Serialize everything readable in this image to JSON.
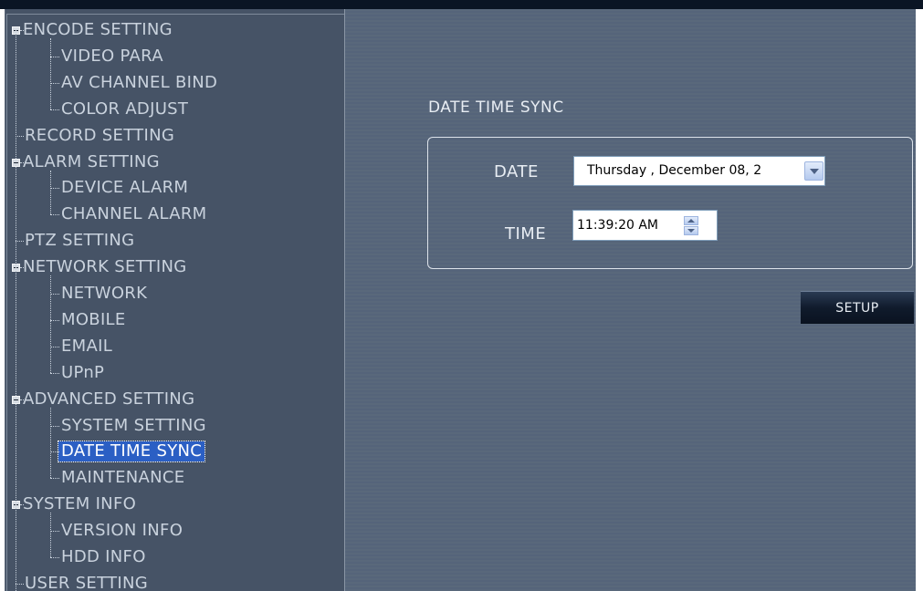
{
  "tree": [
    {
      "label": "ENCODE SETTING",
      "level": 0,
      "expanded": true
    },
    {
      "label": "VIDEO PARA",
      "level": 1
    },
    {
      "label": "AV CHANNEL BIND",
      "level": 1
    },
    {
      "label": "COLOR ADJUST",
      "level": 1
    },
    {
      "label": "RECORD SETTING",
      "level": 0
    },
    {
      "label": "ALARM SETTING",
      "level": 0,
      "expanded": true
    },
    {
      "label": "DEVICE ALARM",
      "level": 1
    },
    {
      "label": "CHANNEL ALARM",
      "level": 1
    },
    {
      "label": "PTZ SETTING",
      "level": 0
    },
    {
      "label": "NETWORK SETTING",
      "level": 0,
      "expanded": true
    },
    {
      "label": "NETWORK",
      "level": 1
    },
    {
      "label": "MOBILE",
      "level": 1
    },
    {
      "label": "EMAIL",
      "level": 1
    },
    {
      "label": "UPnP",
      "level": 1
    },
    {
      "label": "ADVANCED SETTING",
      "level": 0,
      "expanded": true
    },
    {
      "label": "SYSTEM SETTING",
      "level": 1
    },
    {
      "label": "DATE TIME SYNC",
      "level": 1,
      "selected": true
    },
    {
      "label": "MAINTENANCE",
      "level": 1
    },
    {
      "label": "SYSTEM INFO",
      "level": 0,
      "expanded": true
    },
    {
      "label": "VERSION INFO",
      "level": 1
    },
    {
      "label": "HDD INFO",
      "level": 1
    },
    {
      "label": "USER SETTING",
      "level": 0
    }
  ],
  "panel": {
    "title": "DATE TIME SYNC",
    "date_label": "DATE",
    "date_value": "Thursday , December 08, 2",
    "time_label": "TIME",
    "time_value": "11:39:20 AM",
    "setup_label": "SETUP"
  },
  "colors": {
    "selection": "#2b5fc4",
    "panel_bg": "#59687b",
    "tree_bg": "#465366"
  },
  "icons": {
    "expand": "minus-box-icon",
    "dropdown": "chevron-down-icon",
    "spinner": "spinner-arrows-icon"
  }
}
